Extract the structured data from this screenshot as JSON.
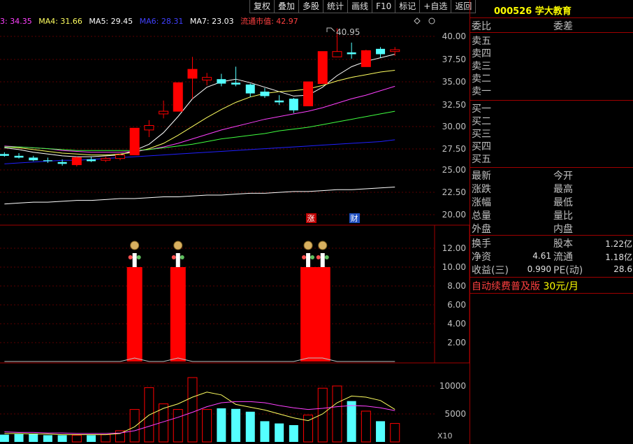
{
  "toolbar": {
    "items": [
      "复权",
      "叠加",
      "多股",
      "统计",
      "画线",
      "F10",
      "标记",
      "+自选",
      "返回"
    ]
  },
  "ma_bar": {
    "ma3": "3: 34.35",
    "ma4": "MA4: 31.66",
    "ma5": "MA5: 29.45",
    "ma6": "MA6: 28.31",
    "ma7": "MA7: 23.03",
    "cap": "流通市值: 42.97"
  },
  "price_axis": [
    "40.00",
    "37.50",
    "35.00",
    "32.50",
    "30.00",
    "27.50",
    "25.00",
    "22.50",
    "20.00"
  ],
  "vol_axis": [
    "12.00",
    "10.00",
    "8.00",
    "6.00",
    "4.00",
    "2.00"
  ],
  "bottom_axis": [
    "10000",
    "5000"
  ],
  "high_label": "40.95",
  "markers": {
    "zhang": "涨",
    "cai": "财"
  },
  "x10_label": "X10",
  "stock": {
    "code": "000526",
    "name": "学大教育"
  },
  "order_book": {
    "header_left": "委比",
    "header_right": "委差",
    "asks": [
      "卖五",
      "卖四",
      "卖三",
      "卖二",
      "卖一"
    ],
    "bids": [
      "买一",
      "买二",
      "买三",
      "买四",
      "买五"
    ]
  },
  "quote": {
    "left": [
      "最新",
      "涨跌",
      "涨幅",
      "总量",
      "外盘"
    ],
    "right": [
      "今开",
      "最高",
      "最低",
      "量比",
      "内盘"
    ]
  },
  "fund": {
    "turnover_label": "换手",
    "equity_label": "股本",
    "equity_value": "1.22亿",
    "netasset_label": "净资",
    "netasset_value": "4.61",
    "float_label": "流通",
    "float_value": "1.18亿",
    "eps_label": "收益(三)",
    "eps_value": "0.990",
    "pe_label": "PE(动)",
    "pe_value": "28.6"
  },
  "promo": {
    "text": "自动续费普及版",
    "price": "30元/月"
  },
  "colors": {
    "up": "#ff0000",
    "down": "#54ffff",
    "border": "#a00000",
    "ma3": "#ffffff",
    "ma4": "#ffff60",
    "ma5": "#ff40ff",
    "ma6": "#40ff40",
    "ma7": "#2020ff"
  },
  "chart_data": [
    {
      "type": "candlestick",
      "title": "",
      "ylim": [
        19,
        41.5
      ],
      "candles": [
        {
          "o": 26.8,
          "h": 27.0,
          "l": 26.5,
          "c": 26.6
        },
        {
          "o": 26.6,
          "h": 26.9,
          "l": 26.3,
          "c": 26.4
        },
        {
          "o": 26.4,
          "h": 26.6,
          "l": 26.0,
          "c": 26.1
        },
        {
          "o": 26.1,
          "h": 26.4,
          "l": 25.8,
          "c": 26.0
        },
        {
          "o": 25.9,
          "h": 26.2,
          "l": 25.5,
          "c": 25.7
        },
        {
          "o": 25.6,
          "h": 26.5,
          "l": 25.4,
          "c": 26.4
        },
        {
          "o": 26.2,
          "h": 26.5,
          "l": 25.9,
          "c": 26.0
        },
        {
          "o": 26.1,
          "h": 26.5,
          "l": 25.9,
          "c": 26.3
        },
        {
          "o": 26.3,
          "h": 26.8,
          "l": 26.1,
          "c": 26.7
        },
        {
          "o": 26.7,
          "h": 29.7,
          "l": 26.7,
          "c": 29.7
        },
        {
          "o": 29.5,
          "h": 30.6,
          "l": 28.7,
          "c": 30.0
        },
        {
          "o": 31.3,
          "h": 32.8,
          "l": 30.8,
          "c": 31.6
        },
        {
          "o": 31.6,
          "h": 34.8,
          "l": 31.6,
          "c": 34.8
        },
        {
          "o": 35.3,
          "h": 37.7,
          "l": 33.0,
          "c": 36.3
        },
        {
          "o": 35.1,
          "h": 35.9,
          "l": 34.5,
          "c": 35.4
        },
        {
          "o": 35.2,
          "h": 35.8,
          "l": 34.4,
          "c": 34.7
        },
        {
          "o": 34.8,
          "h": 36.6,
          "l": 34.4,
          "c": 34.6
        },
        {
          "o": 34.6,
          "h": 34.7,
          "l": 33.2,
          "c": 33.6
        },
        {
          "o": 33.8,
          "h": 34.2,
          "l": 33.1,
          "c": 33.3
        },
        {
          "o": 32.8,
          "h": 33.4,
          "l": 32.3,
          "c": 32.6
        },
        {
          "o": 33.0,
          "h": 33.1,
          "l": 31.4,
          "c": 31.7
        },
        {
          "o": 32.2,
          "h": 34.9,
          "l": 32.2,
          "c": 34.9
        },
        {
          "o": 34.7,
          "h": 38.3,
          "l": 34.7,
          "c": 38.3
        },
        {
          "o": 37.7,
          "h": 40.9,
          "l": 37.7,
          "c": 38.3
        },
        {
          "o": 38.2,
          "h": 39.3,
          "l": 37.5,
          "c": 38.0
        },
        {
          "o": 36.6,
          "h": 38.5,
          "l": 36.6,
          "c": 38.4
        },
        {
          "o": 38.6,
          "h": 38.8,
          "l": 37.6,
          "c": 38.0
        },
        {
          "o": 38.3,
          "h": 38.8,
          "l": 37.8,
          "c": 38.5
        }
      ],
      "series": [
        {
          "name": "MA3",
          "values": [
            27.5,
            27.3,
            27.0,
            26.8,
            26.6,
            26.5,
            26.5,
            26.6,
            26.7,
            27.2,
            27.9,
            29.2,
            31.0,
            33.0,
            34.3,
            34.9,
            35.2,
            34.8,
            34.3,
            33.8,
            33.3,
            33.4,
            34.3,
            35.6,
            36.6,
            37.2,
            37.6,
            38.0
          ]
        },
        {
          "name": "MA4",
          "values": [
            27.6,
            27.5,
            27.3,
            27.1,
            26.9,
            26.8,
            26.7,
            26.7,
            26.8,
            27.0,
            27.4,
            28.0,
            28.9,
            29.9,
            30.9,
            31.8,
            32.6,
            33.2,
            33.6,
            33.8,
            33.9,
            34.1,
            34.5,
            35.0,
            35.4,
            35.7,
            36.0,
            36.2
          ]
        },
        {
          "name": "MA5",
          "values": [
            27.7,
            27.6,
            27.5,
            27.4,
            27.2,
            27.1,
            27.0,
            27.0,
            27.0,
            27.1,
            27.3,
            27.6,
            28.0,
            28.5,
            29.0,
            29.5,
            29.9,
            30.3,
            30.7,
            31.0,
            31.3,
            31.6,
            32.0,
            32.5,
            33.0,
            33.4,
            33.9,
            34.4
          ]
        },
        {
          "name": "MA6",
          "values": [
            27.6,
            27.6,
            27.5,
            27.4,
            27.3,
            27.2,
            27.2,
            27.2,
            27.2,
            27.2,
            27.3,
            27.5,
            27.7,
            27.9,
            28.2,
            28.5,
            28.7,
            28.9,
            29.1,
            29.4,
            29.6,
            29.8,
            30.1,
            30.4,
            30.7,
            31.0,
            31.3,
            31.6
          ]
        },
        {
          "name": "MA7",
          "values": [
            25.7,
            25.8,
            25.9,
            26.0,
            26.1,
            26.1,
            26.2,
            26.3,
            26.4,
            26.5,
            26.6,
            26.7,
            26.8,
            26.9,
            27.0,
            27.1,
            27.2,
            27.3,
            27.4,
            27.5,
            27.6,
            27.7,
            27.8,
            27.9,
            28.0,
            28.1,
            28.2,
            28.4
          ]
        },
        {
          "name": "MA8",
          "values": [
            21.2,
            21.3,
            21.4,
            21.4,
            21.5,
            21.6,
            21.6,
            21.7,
            21.8,
            21.8,
            21.9,
            22.0,
            22.0,
            22.1,
            22.2,
            22.2,
            22.3,
            22.4,
            22.4,
            22.5,
            22.6,
            22.6,
            22.7,
            22.8,
            22.8,
            22.9,
            23.0,
            23.1
          ]
        }
      ]
    },
    {
      "type": "bar",
      "title": "",
      "ylim": [
        0,
        13.5
      ],
      "values": [
        0,
        0,
        0,
        0,
        0,
        0,
        0,
        0,
        0,
        10,
        0,
        0,
        10,
        0,
        0,
        0,
        0,
        0,
        0,
        0,
        0,
        10,
        10,
        0,
        0,
        0,
        0,
        0
      ]
    },
    {
      "type": "bar",
      "title": "",
      "ylim": [
        0,
        12500
      ],
      "values": [
        1300,
        1400,
        1500,
        1200,
        1200,
        1200,
        1200,
        1300,
        2000,
        5800,
        9700,
        6800,
        5800,
        11500,
        5800,
        6000,
        5900,
        5400,
        3700,
        3300,
        3000,
        4800,
        9600,
        10000,
        7300,
        5500,
        3700,
        3300
      ],
      "series": [
        {
          "name": "VMA1",
          "values": [
            1500,
            1500,
            1400,
            1400,
            1300,
            1300,
            1300,
            1300,
            1500,
            2700,
            4800,
            6000,
            6800,
            8000,
            8900,
            8400,
            6700,
            6200,
            5700,
            5000,
            4300,
            3800,
            5000,
            7000,
            8200,
            8000,
            7400,
            5800
          ]
        },
        {
          "name": "VMA2",
          "values": [
            1800,
            1700,
            1700,
            1600,
            1600,
            1500,
            1500,
            1500,
            1600,
            2000,
            2800,
            3600,
            4400,
            5300,
            6300,
            7000,
            7200,
            7200,
            7000,
            6500,
            6100,
            5800,
            6000,
            6300,
            6500,
            6400,
            6100,
            5600
          ]
        }
      ]
    }
  ]
}
